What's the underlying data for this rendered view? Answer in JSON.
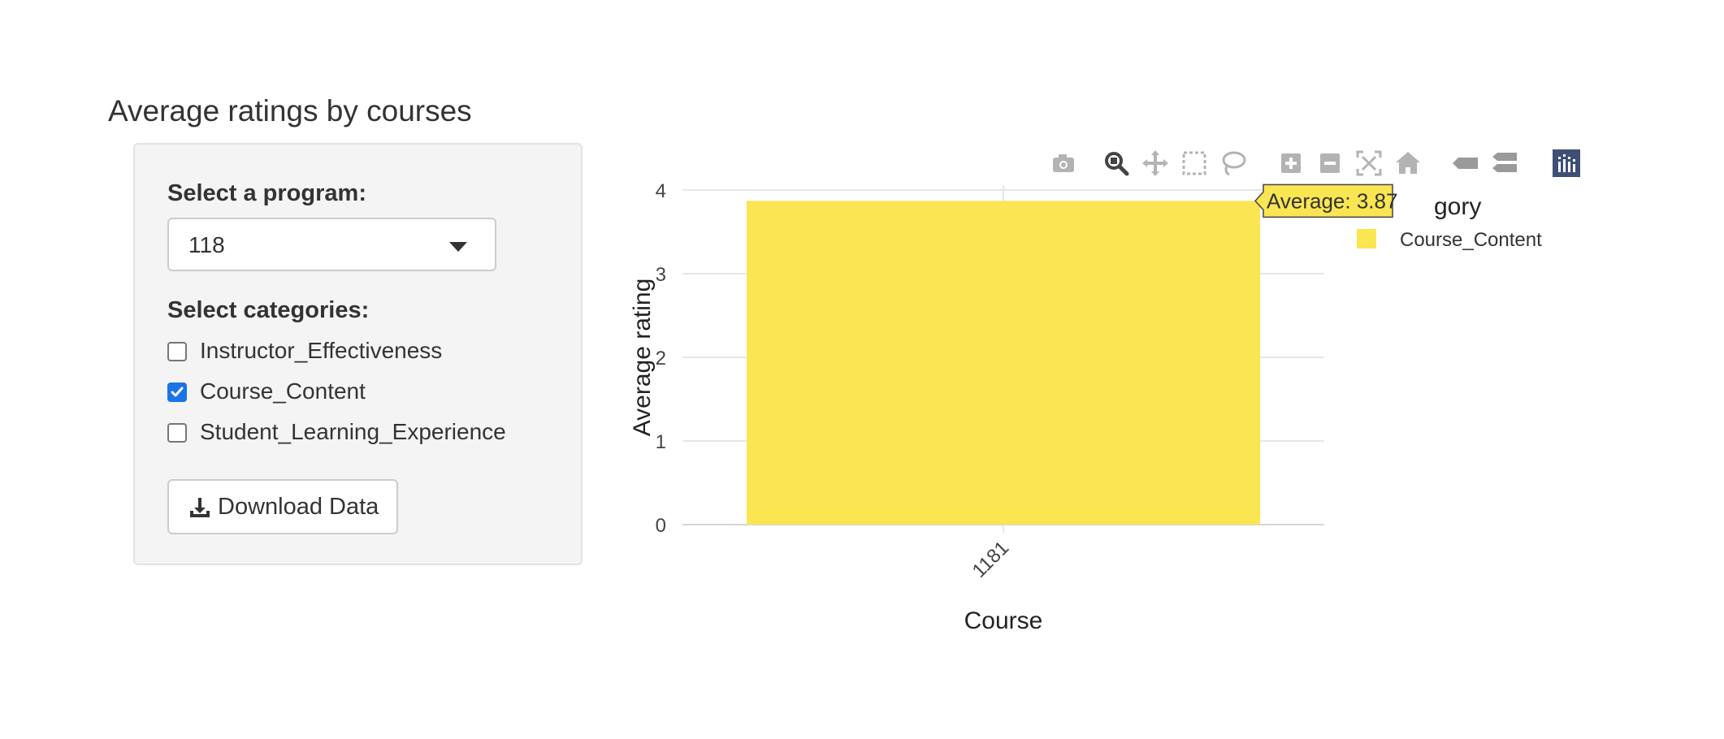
{
  "page": {
    "title": "Average ratings by courses"
  },
  "sidebar": {
    "program_label": "Select a program:",
    "program_value": "118",
    "categories_label": "Select categories:",
    "categories": [
      {
        "label": "Instructor_Effectiveness",
        "checked": false
      },
      {
        "label": "Course_Content",
        "checked": true
      },
      {
        "label": "Student_Learning_Experience",
        "checked": false
      }
    ],
    "download_label": "Download Data",
    "download_icon": "download-icon"
  },
  "modebar": {
    "buttons": [
      {
        "name": "camera-icon",
        "active": false
      },
      {
        "name": "zoom-icon",
        "active": true
      },
      {
        "name": "pan-icon",
        "active": false
      },
      {
        "name": "box-select-icon",
        "active": false
      },
      {
        "name": "lasso-select-icon",
        "active": false
      },
      {
        "name": "zoom-in-icon",
        "active": false
      },
      {
        "name": "zoom-out-icon",
        "active": false
      },
      {
        "name": "autoscale-icon",
        "active": false
      },
      {
        "name": "reset-axes-icon",
        "active": false
      },
      {
        "name": "spike-lines-icon",
        "active": false
      },
      {
        "name": "compare-data-icon",
        "active": false
      },
      {
        "name": "plotly-logo-icon",
        "active": false
      }
    ]
  },
  "chart_data": {
    "type": "bar",
    "categories": [
      "1181"
    ],
    "series": [
      {
        "name": "Course_Content",
        "values": [
          3.87
        ],
        "color": "#fae552"
      }
    ],
    "xlabel": "Course",
    "ylabel": "Average rating",
    "ylim": [
      0,
      4
    ],
    "yticks": [
      0,
      1,
      2,
      3,
      4
    ],
    "legend_title": "gory",
    "legend_placement": "top-right",
    "grid": true,
    "tooltip": "Average: 3.87"
  }
}
